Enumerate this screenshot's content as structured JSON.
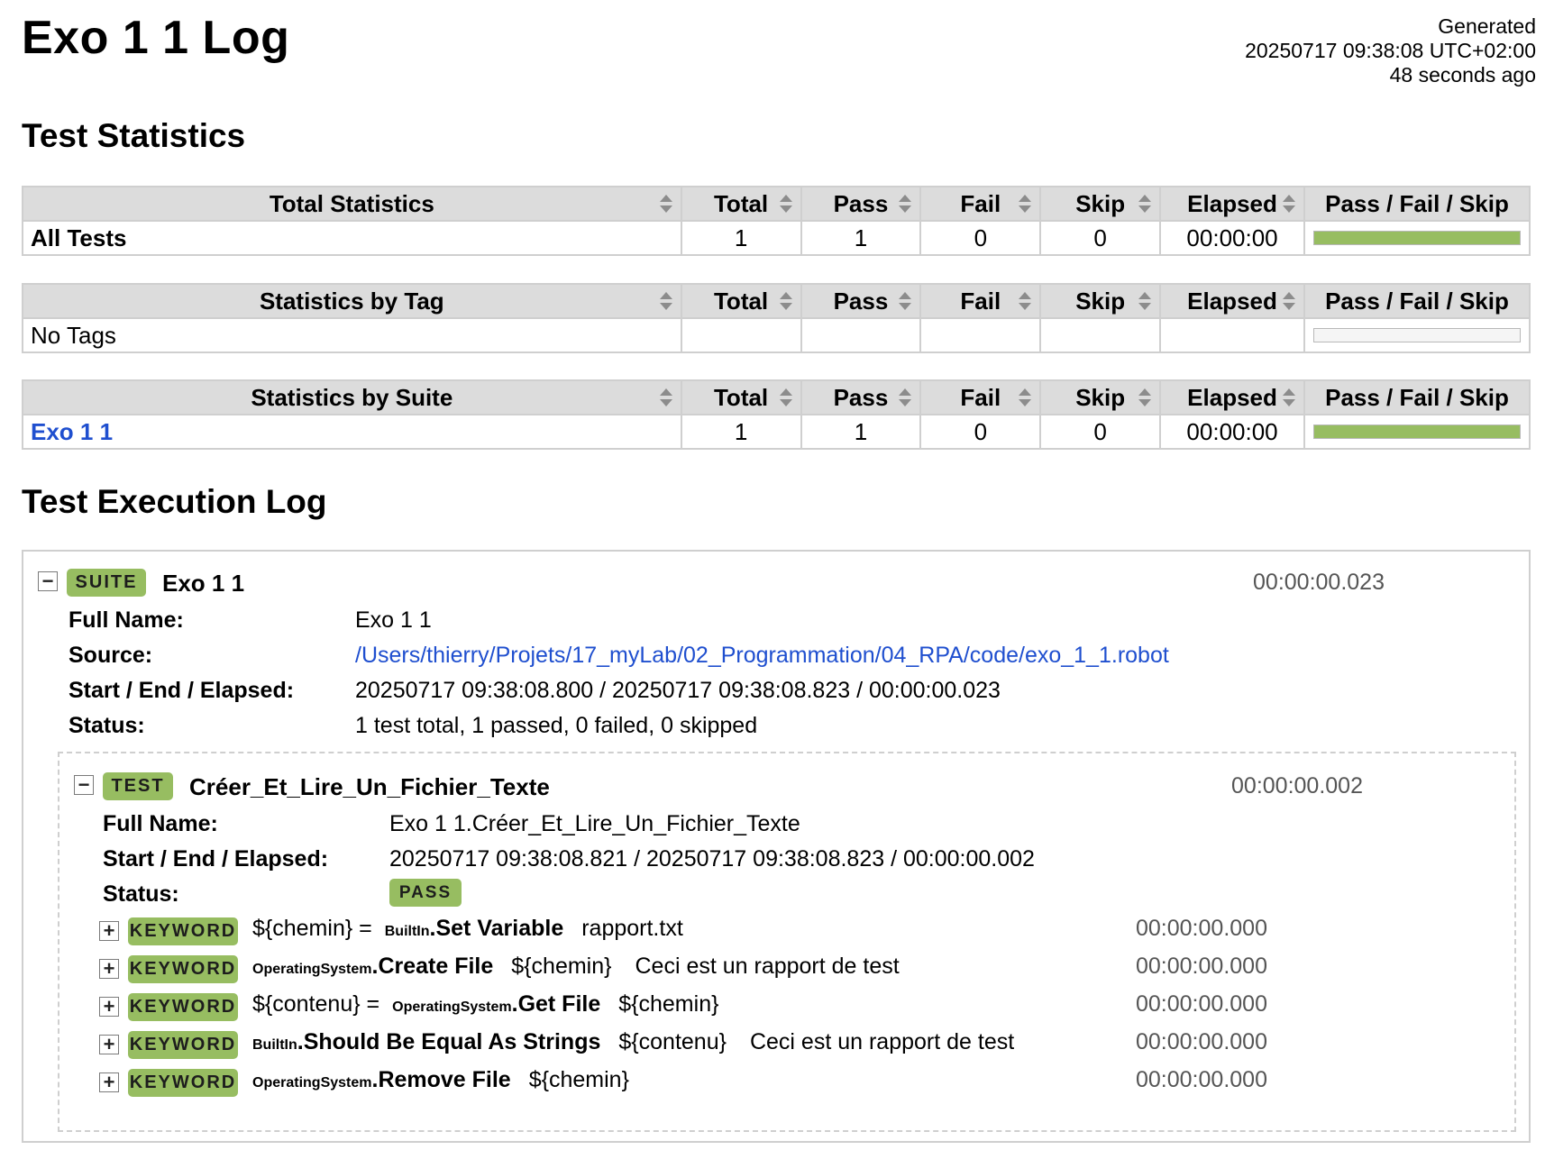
{
  "title": "Exo 1 1 Log",
  "generated": {
    "label": "Generated",
    "timestamp": "20250717 09:38:08 UTC+02:00",
    "ago": "48 seconds ago"
  },
  "sections": {
    "statistics": "Test Statistics",
    "log": "Test Execution Log"
  },
  "column_headers": [
    "Total",
    "Pass",
    "Fail",
    "Skip",
    "Elapsed",
    "Pass / Fail / Skip"
  ],
  "total_statistics": {
    "header": "Total Statistics",
    "rows": [
      {
        "name": "All Tests",
        "total": "1",
        "pass": "1",
        "fail": "0",
        "skip": "0",
        "elapsed": "00:00:00",
        "pass_fraction": 1.0
      }
    ]
  },
  "tag_statistics": {
    "header": "Statistics by Tag",
    "empty_label": "No Tags",
    "pass_fraction": 0
  },
  "suite_statistics": {
    "header": "Statistics by Suite",
    "rows": [
      {
        "name": "Exo 1 1",
        "total": "1",
        "pass": "1",
        "fail": "0",
        "skip": "0",
        "elapsed": "00:00:00",
        "pass_fraction": 1.0
      }
    ]
  },
  "suite": {
    "badge": "SUITE",
    "name": "Exo 1 1",
    "elapsed": "00:00:00.023",
    "labels": {
      "full_name": "Full Name:",
      "source": "Source:",
      "times": "Start / End / Elapsed:",
      "status": "Status:"
    },
    "full_name": "Exo 1 1",
    "source": "/Users/thierry/Projets/17_myLab/02_Programmation/04_RPA/code/exo_1_1.robot",
    "times": "20250717 09:38:08.800 / 20250717 09:38:08.823 / 00:00:00.023",
    "status": "1 test total, 1 passed, 0 failed, 0 skipped"
  },
  "test": {
    "badge": "TEST",
    "name": "Créer_Et_Lire_Un_Fichier_Texte",
    "elapsed": "00:00:00.002",
    "labels": {
      "full_name": "Full Name:",
      "times": "Start / End / Elapsed:",
      "status": "Status:"
    },
    "full_name": "Exo 1 1.Créer_Et_Lire_Un_Fichier_Texte",
    "times": "20250717 09:38:08.821 / 20250717 09:38:08.823 / 00:00:00.002",
    "status": "PASS"
  },
  "keywords": [
    {
      "badge": "KEYWORD",
      "assign": "${chemin} =",
      "library": "BuiltIn",
      "sep": ".",
      "name": "Set Variable",
      "args": [
        "rapport.txt"
      ],
      "elapsed": "00:00:00.000"
    },
    {
      "badge": "KEYWORD",
      "assign": "",
      "library": "OperatingSystem",
      "sep": ".",
      "name": "Create File",
      "args": [
        "${chemin}",
        "Ceci est un rapport de test"
      ],
      "elapsed": "00:00:00.000"
    },
    {
      "badge": "KEYWORD",
      "assign": "${contenu} =",
      "library": "OperatingSystem",
      "sep": ".",
      "name": "Get File",
      "args": [
        "${chemin}"
      ],
      "elapsed": "00:00:00.000"
    },
    {
      "badge": "KEYWORD",
      "assign": "",
      "library": "BuiltIn",
      "sep": ".",
      "name": "Should Be Equal As Strings",
      "args": [
        "${contenu}",
        "Ceci est un rapport de test"
      ],
      "elapsed": "00:00:00.000"
    },
    {
      "badge": "KEYWORD",
      "assign": "",
      "library": "OperatingSystem",
      "sep": ".",
      "name": "Remove File",
      "args": [
        "${chemin}"
      ],
      "elapsed": "00:00:00.000"
    }
  ],
  "toggle_symbols": {
    "expanded": "−",
    "collapsed": "+"
  },
  "colors": {
    "pass": "#97bd61",
    "link": "#1f4fcf",
    "header_bg": "#dcdcdc"
  }
}
